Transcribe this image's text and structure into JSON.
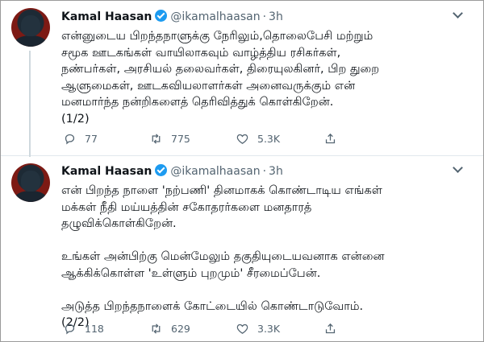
{
  "tweets": [
    {
      "name": "Kamal Haasan",
      "handle": "@ikamalhaasan",
      "dot": "·",
      "time": "3h",
      "text": "என்னுடைய பிறந்தநாளுக்கு நேரிலும்,தொலைபேசி மற்றும்\nசமூக ஊடகங்கள் வாயிலாகவும் வாழ்த்திய ரசிகர்கள்,\nநண்பர்கள், அரசியல் தலைவர்கள், திரையுலகினர், பிற துறை\nஆளுமைகள், ஊடகவியலாளர்கள் அனைவருக்கும் என்\nமனமார்ந்த நன்றிகளைத் தெரிவித்துக் கொள்கிறேன்.\n(1/2)",
      "replies": "77",
      "retweets": "775",
      "likes": "5.3K"
    },
    {
      "name": "Kamal Haasan",
      "handle": "@ikamalhaasan",
      "dot": "·",
      "time": "3h",
      "text": "என் பிறந்த நாளை 'நற்பணி' தினமாகக் கொண்டாடிய எங்கள்\nமக்கள் நீதி மய்யத்தின் சகோதரர்களை மனதாரத்\nதழுவிக்கொள்கிறேன்.\n\nஉங்கள் அன்பிற்கு மென்மேலும் தகுதியுடையவனாக என்னை\nஆக்கிக்கொள்ள 'உள்ளும் புறமும்' சீரமைப்பேன்.\n\nஅடுத்த பிறந்தநாளைக் கோட்டையில் கொண்டாடுவோம்.\n(2/2)",
      "replies": "118",
      "retweets": "629",
      "likes": "3.3K"
    }
  ],
  "icons": {
    "reply": "reply-icon",
    "retweet": "retweet-icon",
    "like": "heart-icon",
    "share": "share-icon",
    "verified": "verified-badge-icon",
    "more": "chevron-down-icon"
  },
  "colors": {
    "verified": "#1d9bf0",
    "muted": "#536471",
    "text": "#0f1419"
  }
}
